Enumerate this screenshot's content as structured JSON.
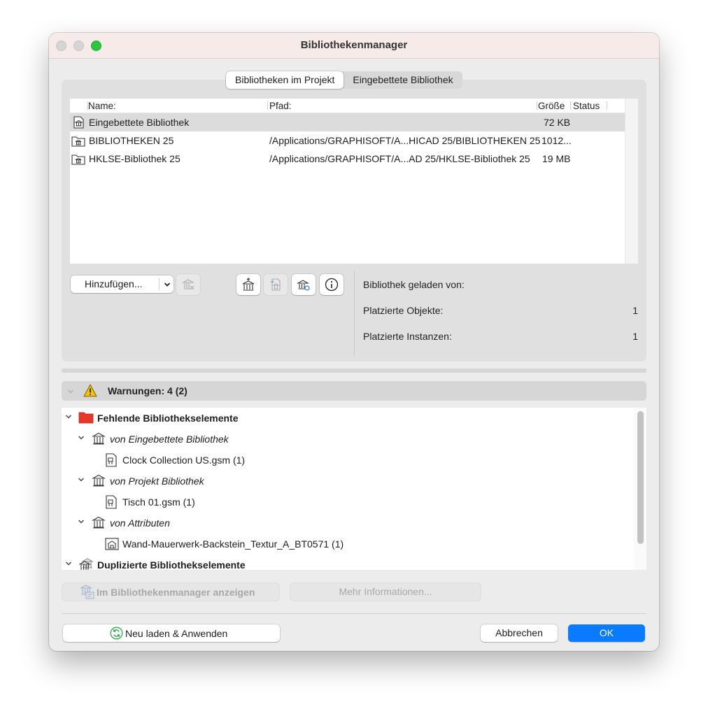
{
  "window": {
    "title": "Bibliothekenmanager"
  },
  "tabs": [
    {
      "label": "Bibliotheken im Projekt",
      "active": true
    },
    {
      "label": "Eingebettete Bibliothek",
      "active": false
    }
  ],
  "library_table": {
    "columns": {
      "name": "Name:",
      "path": "Pfad:",
      "size": "Größe",
      "status": "Status"
    },
    "rows": [
      {
        "name": "Eingebettete Bibliothek",
        "path": "",
        "size": "72 KB",
        "status": "",
        "icon": "embedded-library-icon",
        "selected": true
      },
      {
        "name": "BIBLIOTHEKEN 25",
        "path": "/Applications/GRAPHISOFT/A...HICAD 25/BIBLIOTHEKEN 25",
        "size": "1012...",
        "status": "",
        "icon": "folder-library-icon",
        "selected": false
      },
      {
        "name": "HKLSE-Bibliothek 25",
        "path": "/Applications/GRAPHISOFT/A...AD 25/HKLSE-Bibliothek 25",
        "size": "19 MB",
        "status": "",
        "icon": "folder-library-icon",
        "selected": false
      }
    ]
  },
  "toolbar": {
    "add_label": "Hinzufügen...",
    "icons": [
      "remove-library-icon",
      "library-export-icon",
      "library-import-icon",
      "library-settings-icon",
      "info-icon"
    ]
  },
  "info": {
    "loaded_from_label": "Bibliothek geladen von:",
    "placed_objects_label": "Platzierte Objekte:",
    "placed_objects_value": "1",
    "placed_instances_label": "Platzierte Instanzen:",
    "placed_instances_value": "1"
  },
  "warnings": {
    "header": "Warnungen: 4 (2)",
    "tree": [
      {
        "label": "Fehlende Bibliothekselemente",
        "level": 0,
        "style": "bold",
        "icon": "red-folder-icon"
      },
      {
        "label": "von Eingebettete Bibliothek",
        "level": 1,
        "style": "italic",
        "icon": "library-icon"
      },
      {
        "label": "Clock Collection US.gsm (1)",
        "level": 2,
        "style": "normal",
        "icon": "object-file-icon"
      },
      {
        "label": "von Projekt Bibliothek",
        "level": 1,
        "style": "italic",
        "icon": "library-icon"
      },
      {
        "label": "Tisch 01.gsm (1)",
        "level": 2,
        "style": "normal",
        "icon": "object-file-icon"
      },
      {
        "label": "von Attributen",
        "level": 1,
        "style": "italic",
        "icon": "library-icon"
      },
      {
        "label": "Wand-Mauerwerk-Backstein_Textur_A_BT0571 (1)",
        "level": 2,
        "style": "normal",
        "icon": "texture-file-icon"
      },
      {
        "label": "Duplizierte Bibliothekselemente",
        "level": 0,
        "style": "bold",
        "icon": "duplicate-library-icon"
      }
    ]
  },
  "actions": {
    "show_in_manager": "Im Bibliothekenmanager anzeigen",
    "more_info": "Mehr Informationen...",
    "reload_apply": "Neu laden & Anwenden",
    "cancel": "Abbrechen",
    "ok": "OK"
  },
  "colors": {
    "accent": "#0a7bff",
    "warning": "#f5c400",
    "missing_folder": "#e8362a",
    "reload_icon": "#2fa84f"
  }
}
